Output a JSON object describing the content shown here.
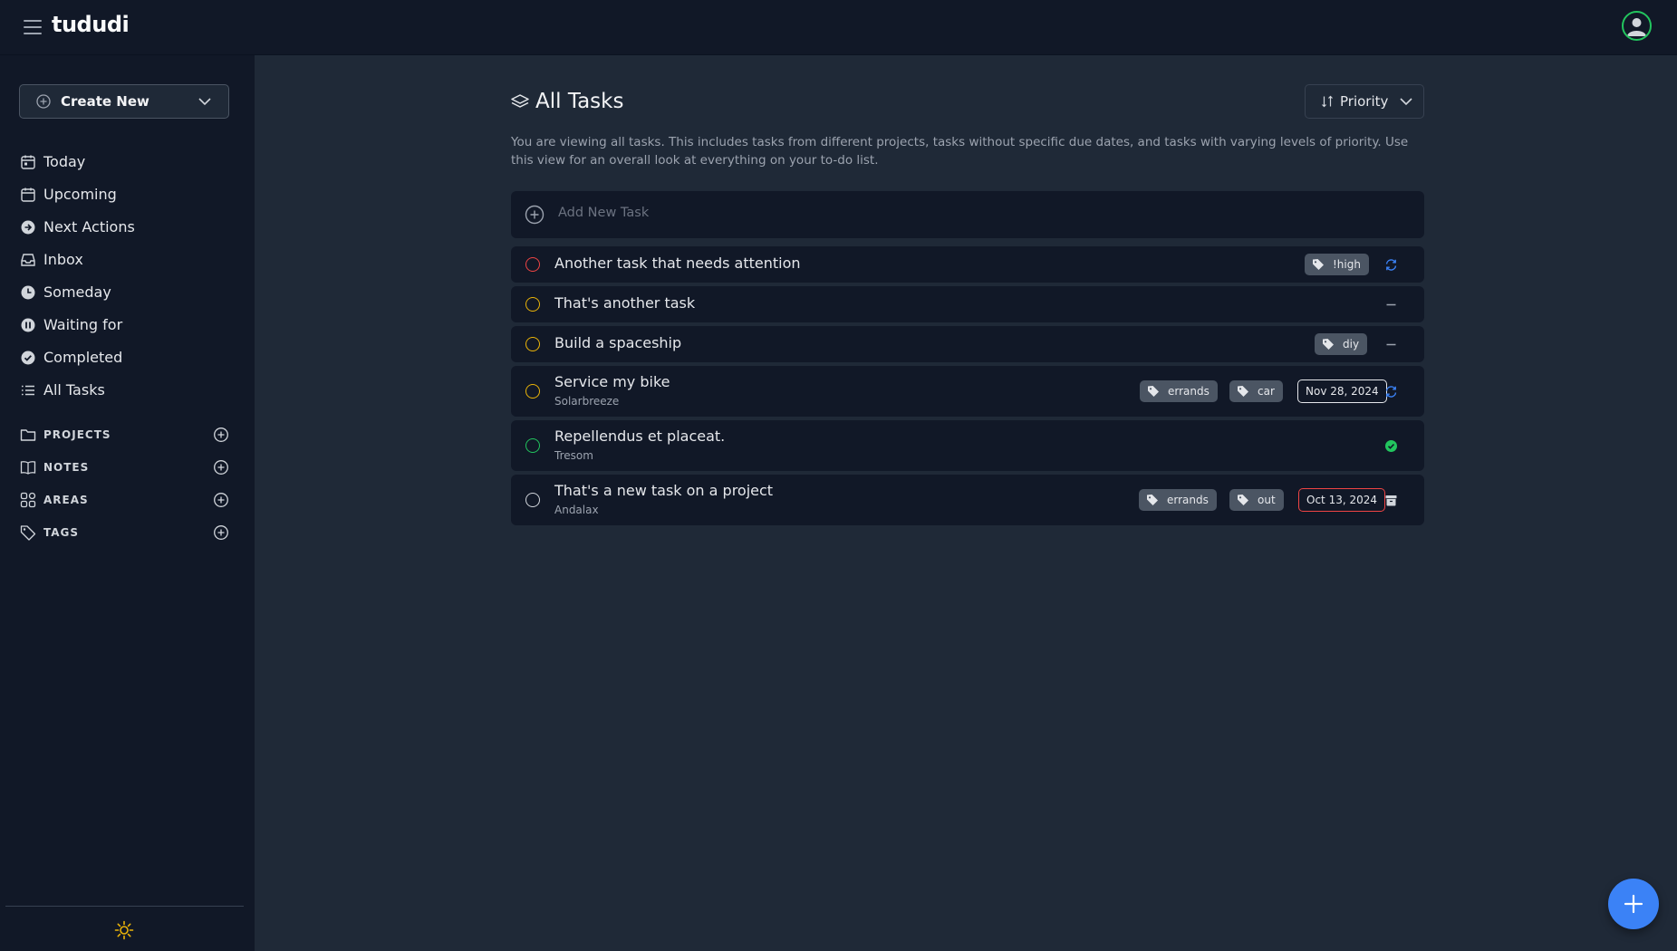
{
  "app": {
    "name": "tududi"
  },
  "sidebar": {
    "create_new_label": "Create New",
    "nav_items": [
      {
        "label": "Today",
        "icon": "calendar-icon"
      },
      {
        "label": "Upcoming",
        "icon": "calendar-icon"
      },
      {
        "label": "Next Actions",
        "icon": "arrow-circle-icon"
      },
      {
        "label": "Inbox",
        "icon": "inbox-icon"
      },
      {
        "label": "Someday",
        "icon": "clock-icon"
      },
      {
        "label": "Waiting for",
        "icon": "pause-circle-icon"
      },
      {
        "label": "Completed",
        "icon": "check-circle-icon"
      },
      {
        "label": "All Tasks",
        "icon": "list-icon"
      }
    ],
    "sections": [
      {
        "label": "PROJECTS",
        "icon": "folder-icon"
      },
      {
        "label": "NOTES",
        "icon": "book-icon"
      },
      {
        "label": "AREAS",
        "icon": "grid-icon"
      },
      {
        "label": "TAGS",
        "icon": "tag-icon"
      }
    ]
  },
  "main": {
    "title": "All Tasks",
    "sort_label": "Priority",
    "description": "You are viewing all tasks. This includes tasks from different projects, tasks without specific due dates, and tasks with varying levels of priority. Use this view for an overall look at everything on your to-do list.",
    "add_task_placeholder": "Add New Task",
    "tasks": [
      {
        "name": "Another task that needs attention",
        "project": "",
        "tags": [
          "!high"
        ],
        "due": "",
        "status_icon": "repeat-icon",
        "priority_color": "#ef4444"
      },
      {
        "name": "That's another task",
        "project": "",
        "tags": [],
        "due": "",
        "status_icon": "dash-icon",
        "priority_color": "#eab308"
      },
      {
        "name": "Build a spaceship",
        "project": "",
        "tags": [
          "diy"
        ],
        "due": "",
        "status_icon": "dash-icon",
        "priority_color": "#eab308"
      },
      {
        "name": "Service my bike",
        "project": "Solarbreeze",
        "tags": [
          "errands",
          "car"
        ],
        "due": "Nov 28, 2024",
        "status_icon": "repeat-icon",
        "priority_color": "#eab308"
      },
      {
        "name": "Repellendus et placeat.",
        "project": "Tresom",
        "tags": [],
        "due": "",
        "status_icon": "check-circle-icon",
        "priority_color": "#22c55e"
      },
      {
        "name": "That's a new task on a project",
        "project": "Andalax",
        "tags": [
          "errands",
          "out"
        ],
        "due": "Oct 13, 2024",
        "status_icon": "archive-icon",
        "priority_color": "#d1d5db"
      }
    ]
  },
  "colors": {
    "accent": "#3b82f6",
    "sidebar_bg": "#111827",
    "main_bg": "#1f2937",
    "overdue": "#ef4444"
  }
}
